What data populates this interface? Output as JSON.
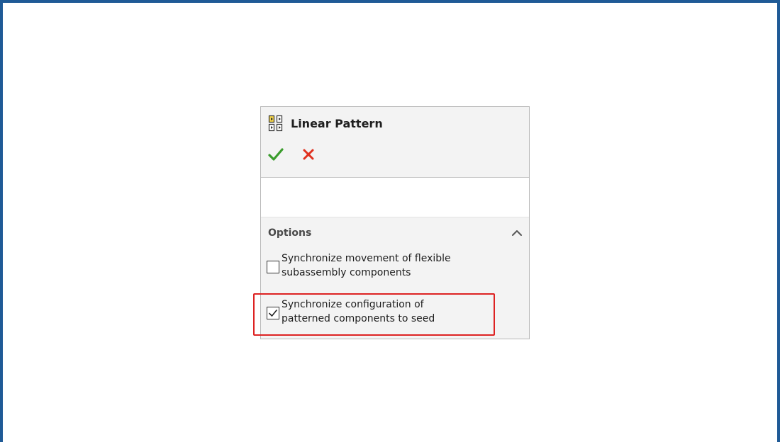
{
  "panel": {
    "title": "Linear Pattern",
    "icon": "linear-pattern-icon",
    "ok_icon": "checkmark-icon",
    "cancel_icon": "close-icon",
    "ok_color": "#3a9c2c",
    "cancel_color": "#e0301e"
  },
  "options": {
    "header": "Options",
    "collapse_icon": "chevron-up-icon",
    "items": [
      {
        "line1": "Synchronize movement of flexible",
        "line2": "subassembly components",
        "checked": false
      },
      {
        "line1": "Synchronize configuration of",
        "line2": "patterned components to seed",
        "checked": true
      }
    ]
  },
  "highlight_color": "#dd2222",
  "frame_color": "#1f5a96"
}
